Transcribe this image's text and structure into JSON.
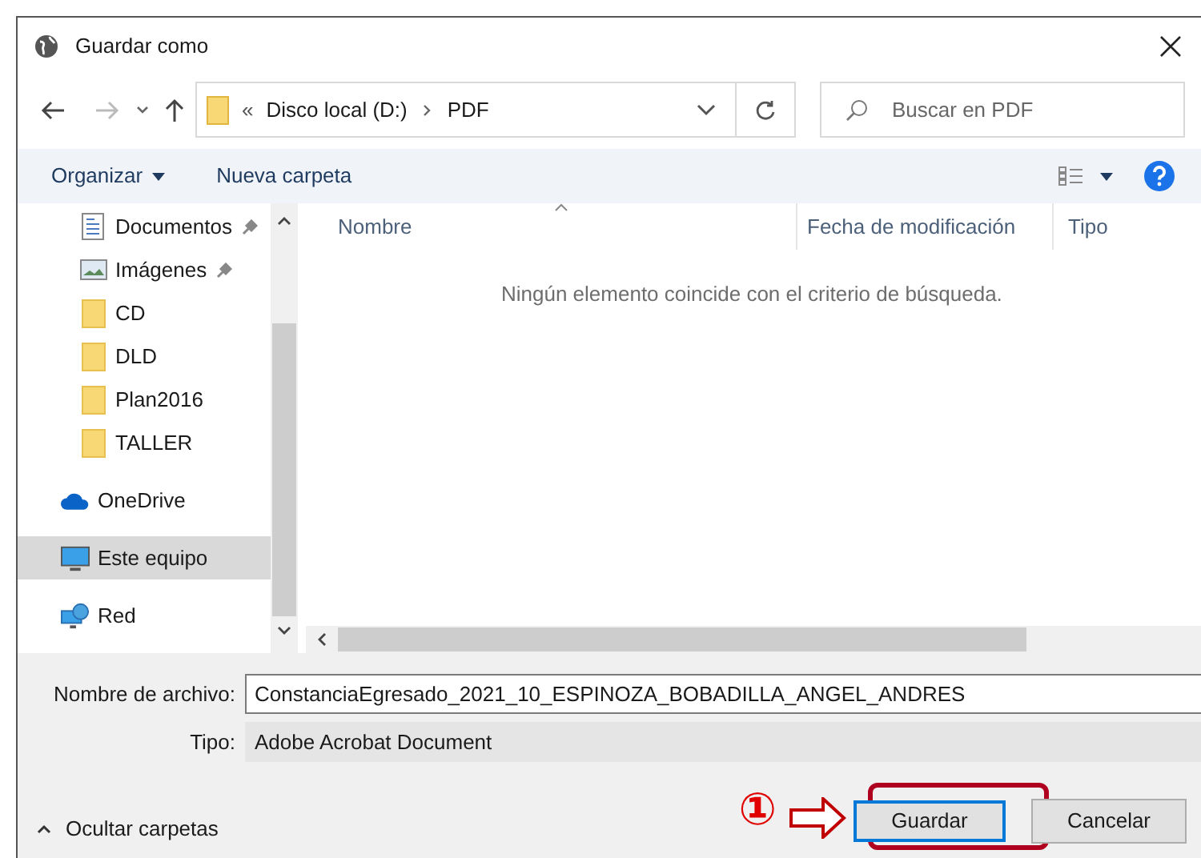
{
  "window": {
    "title": "Guardar como"
  },
  "address": {
    "overflow": "«",
    "segments": [
      "Disco local (D:)",
      "PDF"
    ]
  },
  "search": {
    "placeholder": "Buscar en PDF"
  },
  "toolbar": {
    "organize": "Organizar",
    "new_folder": "Nueva carpeta"
  },
  "sidebar": {
    "sections": [
      {
        "items": [
          {
            "label": "Documentos",
            "kind": "documents",
            "pinned": true,
            "selected": false
          },
          {
            "label": "Imágenes",
            "kind": "pictures",
            "pinned": true,
            "selected": false
          },
          {
            "label": "CD",
            "kind": "folder",
            "pinned": false,
            "selected": false
          },
          {
            "label": "DLD",
            "kind": "folder",
            "pinned": false,
            "selected": false
          },
          {
            "label": "Plan2016",
            "kind": "folder",
            "pinned": false,
            "selected": false
          },
          {
            "label": "TALLER",
            "kind": "folder",
            "pinned": false,
            "selected": false
          }
        ]
      },
      {
        "items": [
          {
            "label": "OneDrive",
            "kind": "cloud",
            "pinned": false,
            "selected": false
          }
        ]
      },
      {
        "items": [
          {
            "label": "Este equipo",
            "kind": "computer",
            "pinned": false,
            "selected": true
          }
        ]
      },
      {
        "items": [
          {
            "label": "Red",
            "kind": "network",
            "pinned": false,
            "selected": false
          }
        ]
      }
    ]
  },
  "columns": [
    {
      "label": "Nombre",
      "sorted": true
    },
    {
      "label": "Fecha de modificación",
      "sorted": false
    },
    {
      "label": "Tipo",
      "sorted": false
    }
  ],
  "empty_message": "Ningún elemento coincide con el criterio de búsqueda.",
  "form": {
    "fields": [
      {
        "label": "Nombre de archivo:",
        "value": "ConstanciaEgresado_2021_10_ESPINOZA_BOBADILLA_ANGEL_ANDRES",
        "kind": "input"
      },
      {
        "label": "Tipo:",
        "value": "Adobe Acrobat Document",
        "kind": "select"
      }
    ]
  },
  "footer": {
    "toggle": "Ocultar carpetas",
    "buttons": [
      {
        "label": "Guardar",
        "default": true
      },
      {
        "label": "Cancelar",
        "default": false
      }
    ]
  },
  "annotation": {
    "number": "①"
  }
}
